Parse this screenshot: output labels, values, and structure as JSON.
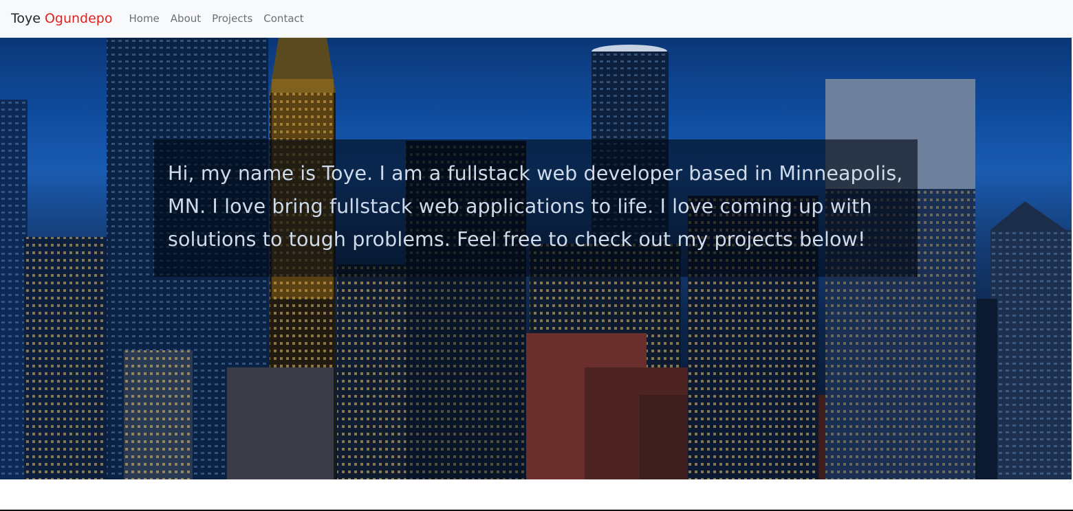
{
  "navbar": {
    "brand_first": "Toye",
    "brand_last": "Ogundepo",
    "links": [
      {
        "label": "Home"
      },
      {
        "label": "About"
      },
      {
        "label": "Projects"
      },
      {
        "label": "Contact"
      }
    ]
  },
  "hero": {
    "intro": "Hi, my name is Toye. I am a fullstack web developer based in Minneapolis, MN. I love bring fullstack web applications to life. I love coming up with solutions to tough problems. Feel free to check out my projects below!"
  },
  "colors": {
    "brand_accent": "#e0211d",
    "navbar_bg": "#f8f9fa",
    "nav_link": "#6c6f73",
    "intro_text": "#cfdbea"
  }
}
